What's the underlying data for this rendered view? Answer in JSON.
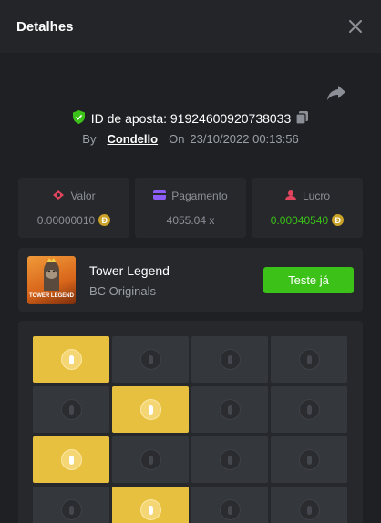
{
  "header": {
    "title": "Detalhes"
  },
  "bet": {
    "id_label": "ID de aposta:",
    "id_value": "91924600920738033",
    "by_label": "By",
    "user": "Condello",
    "on_label": "On",
    "datetime": "23/10/2022 00:13:56"
  },
  "stats": [
    {
      "label": "Valor",
      "value": "0.00000010",
      "icon": "money-icon",
      "icon_color": "#e0455d"
    },
    {
      "label": "Pagamento",
      "value": "4055.04 x",
      "icon": "wallet-icon",
      "icon_color": "#8b5cf6"
    },
    {
      "label": "Lucro",
      "value": "0.00040540",
      "icon": "profit-icon",
      "icon_color": "#e0455d",
      "value_color": "#3bc117"
    }
  ],
  "game": {
    "thumb_label": "TOWER LEGEND",
    "name": "Tower Legend",
    "provider": "BC Originals",
    "button": "Teste já"
  },
  "board": {
    "rows": [
      [
        "gold",
        "dark",
        "dark",
        "dark"
      ],
      [
        "dark",
        "gold",
        "dark",
        "dark"
      ],
      [
        "gold",
        "dark",
        "dark",
        "dark"
      ],
      [
        "dark",
        "gold",
        "dark",
        "dark"
      ]
    ]
  },
  "colors": {
    "accent_green": "#3bc117",
    "gold": "#e8c03f",
    "coin": "#c9a227"
  }
}
